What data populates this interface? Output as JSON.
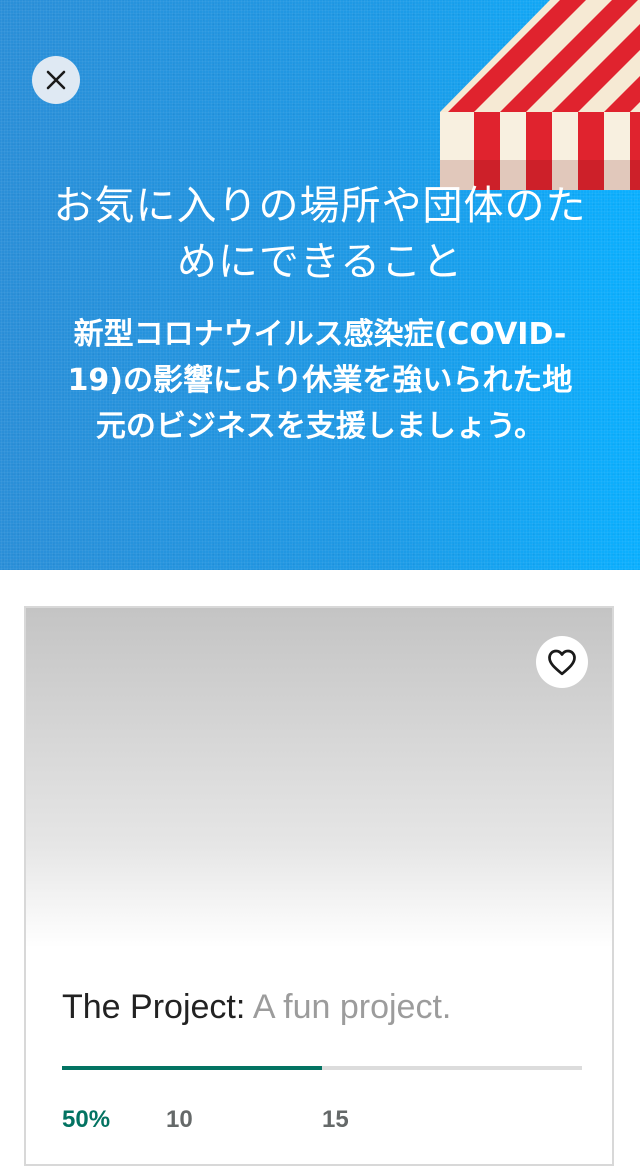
{
  "hero": {
    "close_icon": "close-icon",
    "title": "お気に入りの場所や団体のためにできること",
    "subtitle": "新型コロナウイルス感染症(COVID- 19)の影響により休業を強いられた地元のビジネスを支援しましょう。",
    "background_color": "#1e9ae6"
  },
  "card": {
    "favorite_icon": "heart-icon",
    "project_name": "The Project:",
    "project_tagline": "A fun project.",
    "progress_percent": 50,
    "accent_color": "#037362",
    "stats": {
      "funded": "50%",
      "second": "10",
      "third": "15"
    }
  }
}
